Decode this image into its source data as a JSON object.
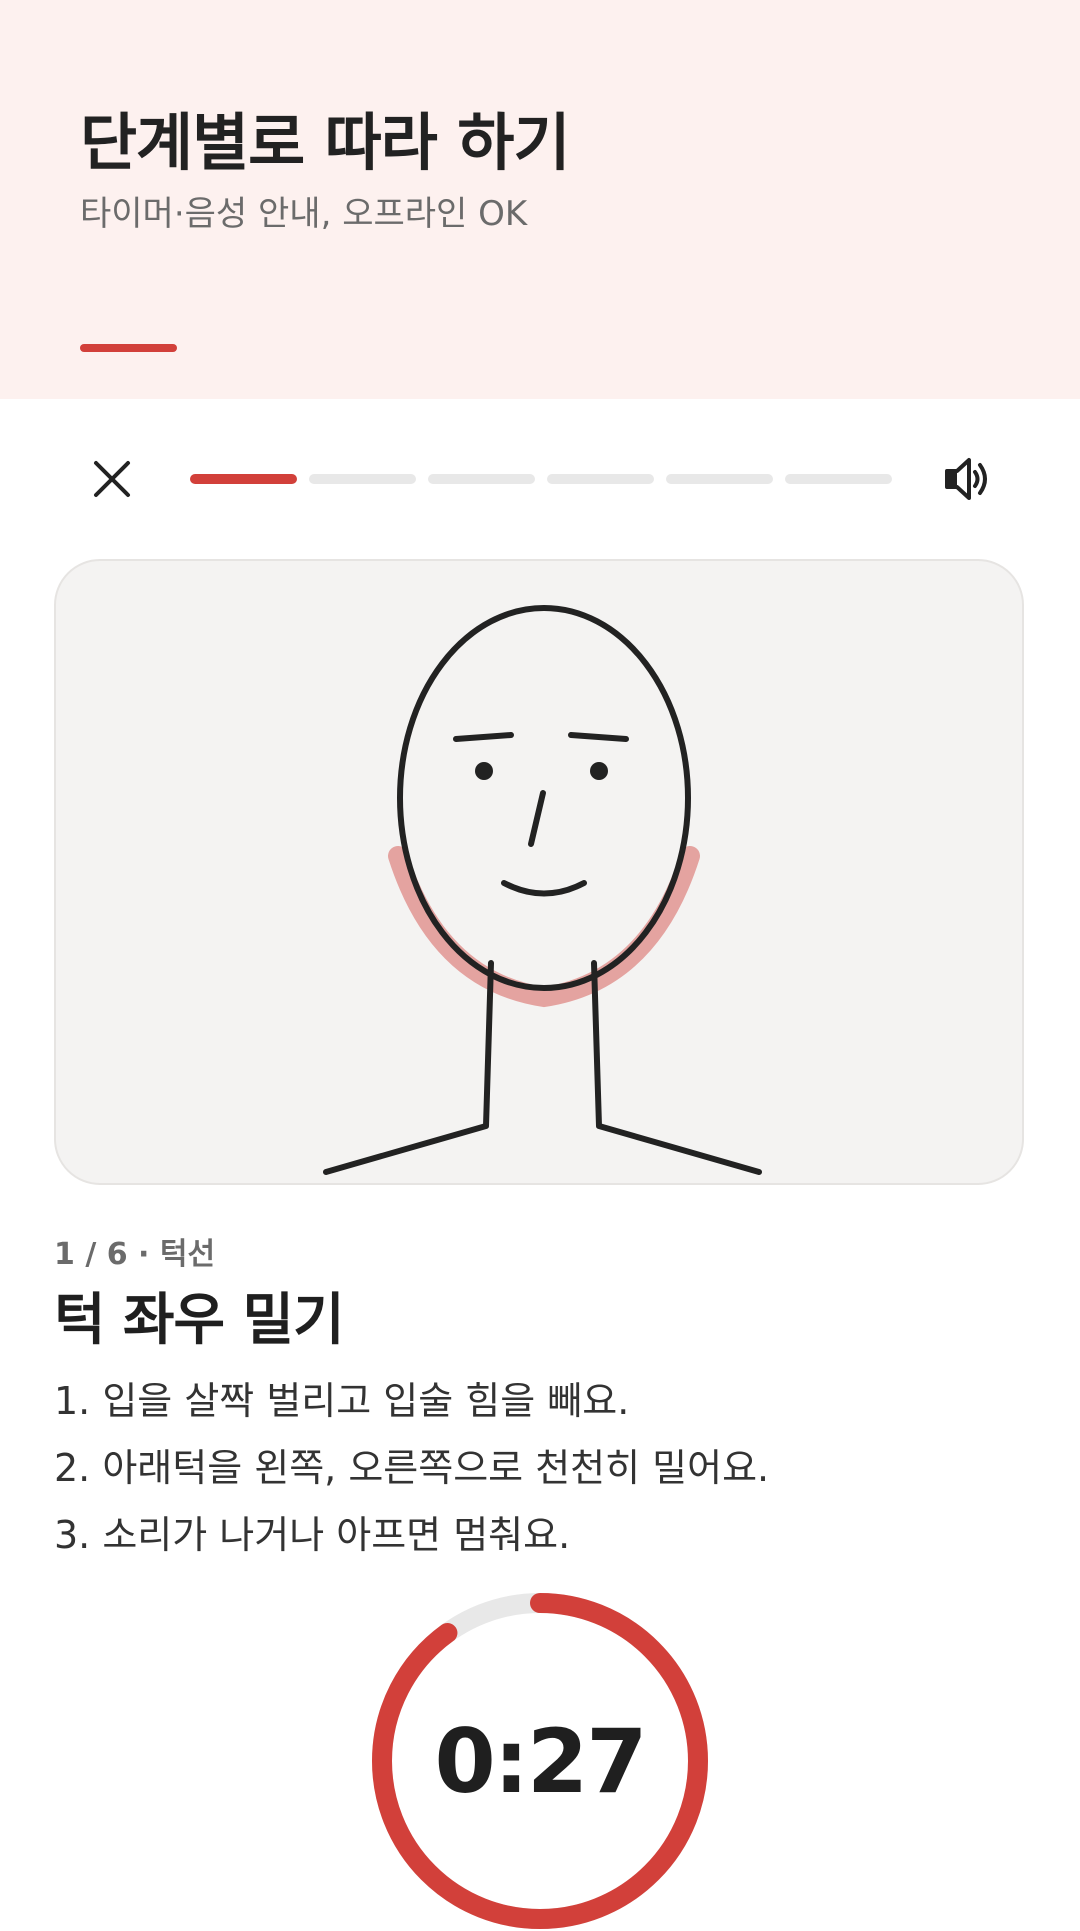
{
  "header": {
    "title": "단계별로 따라 하기",
    "subtitle": "타이머·음성 안내, 오프라인 OK"
  },
  "topbar": {
    "close_icon": "close-icon",
    "sound_icon": "speaker-icon",
    "progress": {
      "current_step": 1,
      "total_steps": 6
    }
  },
  "illustration": {
    "icon": "face-jaw-illustration",
    "highlight_area": "jawline"
  },
  "step": {
    "meta": "1 / 6 · 턱선",
    "title": "턱 좌우 밀기",
    "instructions": [
      "1. 입을 살짝 벌리고 입술 힘을 빼요.",
      "2. 아래턱을 왼쪽, 오른쪽으로 천천히 밀어요.",
      "3. 소리가 나거나 아프면 멈춰요."
    ]
  },
  "timer": {
    "display": "0:27",
    "remaining_fraction": 0.9
  },
  "colors": {
    "accent": "#d2403a",
    "header_bg": "#fdf1ef",
    "track": "#e8e8e8",
    "highlight": "#e4a3a0",
    "card_bg": "#f4f3f2"
  }
}
